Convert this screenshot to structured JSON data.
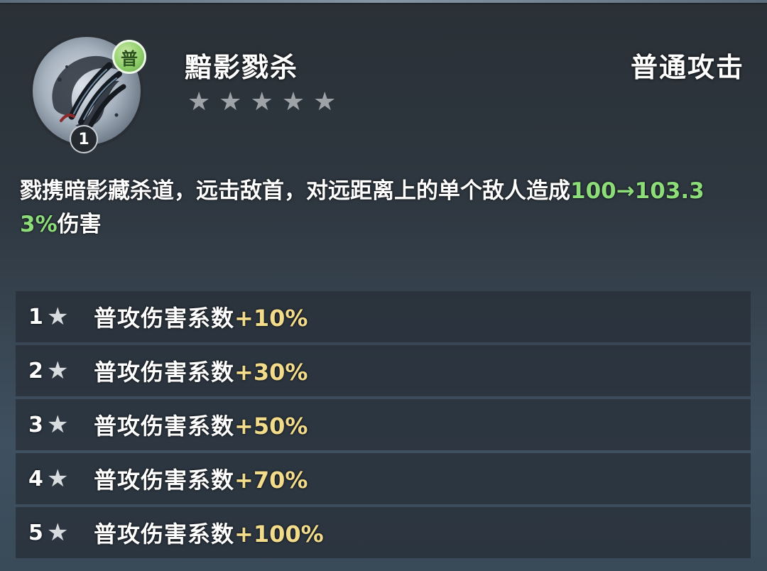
{
  "skill": {
    "name": "黯影戮杀",
    "type": "普通攻击",
    "grade_badge": "普",
    "level": "1",
    "icon": "shadow-claw-icon",
    "stars_total": 5,
    "stars_filled": 0
  },
  "description": {
    "text_before": "戮携暗影藏杀道，远击敌首，对远距离上的单个敌人造成",
    "value": "100→103.33%",
    "text_after": "伤害"
  },
  "upgrades": [
    {
      "level": "1",
      "label": "普攻伤害系数",
      "bonus": "+10%"
    },
    {
      "level": "2",
      "label": "普攻伤害系数",
      "bonus": "+30%"
    },
    {
      "level": "3",
      "label": "普攻伤害系数",
      "bonus": "+50%"
    },
    {
      "level": "4",
      "label": "普攻伤害系数",
      "bonus": "+70%"
    },
    {
      "level": "5",
      "label": "普攻伤害系数",
      "bonus": "+100%"
    }
  ],
  "colors": {
    "value_green": "#8ddc7a",
    "bonus_gold": "#f2dc8c",
    "badge_green": "#8fcf6a"
  }
}
